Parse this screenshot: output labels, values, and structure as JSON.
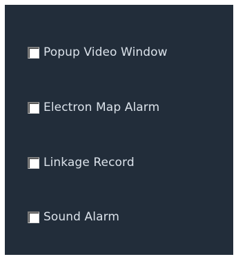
{
  "options": [
    {
      "label": "Popup Video Window",
      "checked": false
    },
    {
      "label": "Electron Map Alarm",
      "checked": false
    },
    {
      "label": "Linkage Record",
      "checked": false
    },
    {
      "label": "Sound Alarm",
      "checked": false
    }
  ],
  "colors": {
    "panel_background": "#222d3a",
    "label_text": "#dbe2ea",
    "checkbox_fill": "#ffffff"
  }
}
